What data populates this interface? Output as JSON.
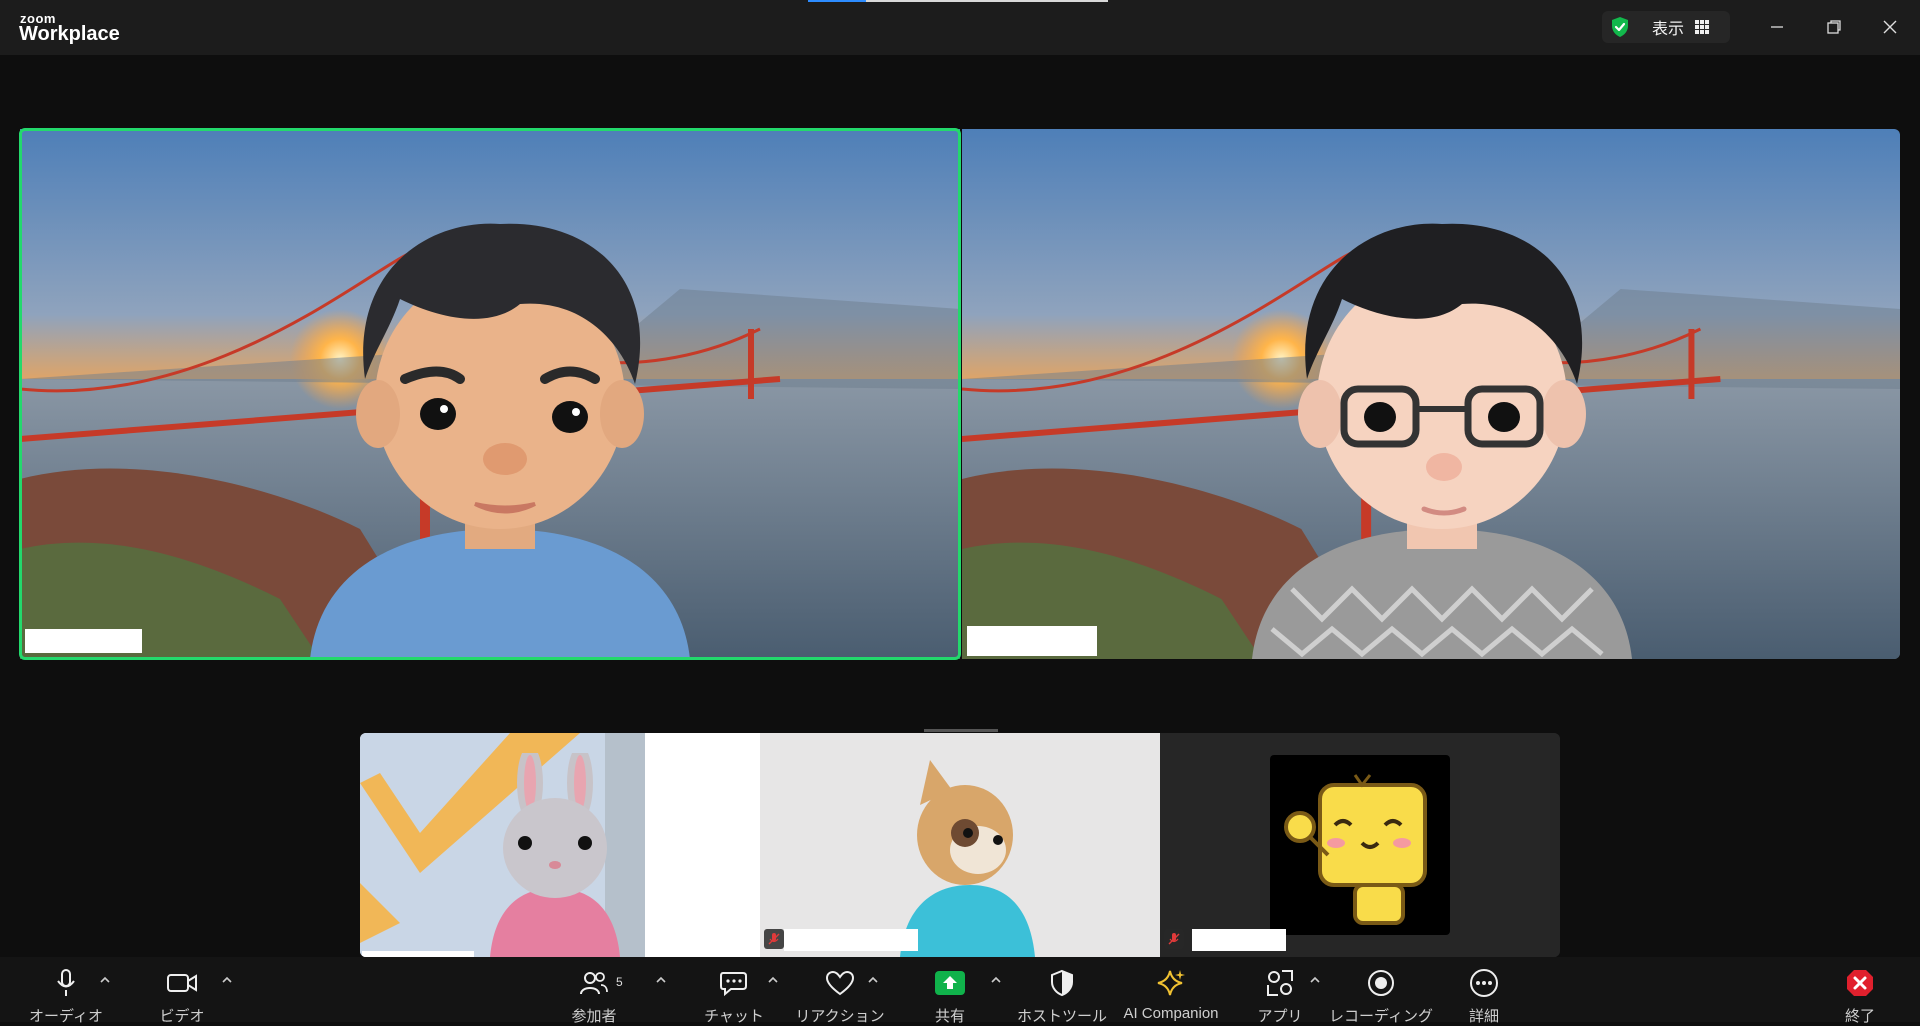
{
  "app": {
    "brand_small": "zoom",
    "brand_main": "Workplace"
  },
  "header": {
    "view_label": "表示",
    "security_icon": "shield-check-icon",
    "layout_icon": "grid-icon"
  },
  "window_controls": [
    "minimize-icon",
    "restore-icon",
    "close-icon"
  ],
  "colors": {
    "speaking": "#23d96c",
    "share_green": "#10b24b",
    "end_red": "#e0202d",
    "ai_gold": "#f1c232"
  },
  "video_tiles": [
    {
      "avatar": "boy avatar, blue shirt",
      "speaking": true,
      "name_hidden": true
    },
    {
      "avatar": "boy avatar with glasses, grey sweater",
      "speaking": false,
      "name_hidden": true
    }
  ],
  "strip_tiles": [
    {
      "avatar": "rabbit avatar, pink hoodie",
      "muted": false
    },
    {
      "avatar": "cat avatar, cyan hoodie",
      "muted": true
    },
    {
      "avatar": "yellow mascot sticker",
      "muted": true
    }
  ],
  "toolbar": {
    "audio": "オーディオ",
    "video": "ビデオ",
    "participants": "参加者",
    "participants_count": "5",
    "chat": "チャット",
    "reaction": "リアクション",
    "share": "共有",
    "host_tools": "ホストツール",
    "ai_companion": "AI Companion",
    "apps": "アプリ",
    "recording": "レコーディング",
    "more": "詳細",
    "end": "終了"
  }
}
